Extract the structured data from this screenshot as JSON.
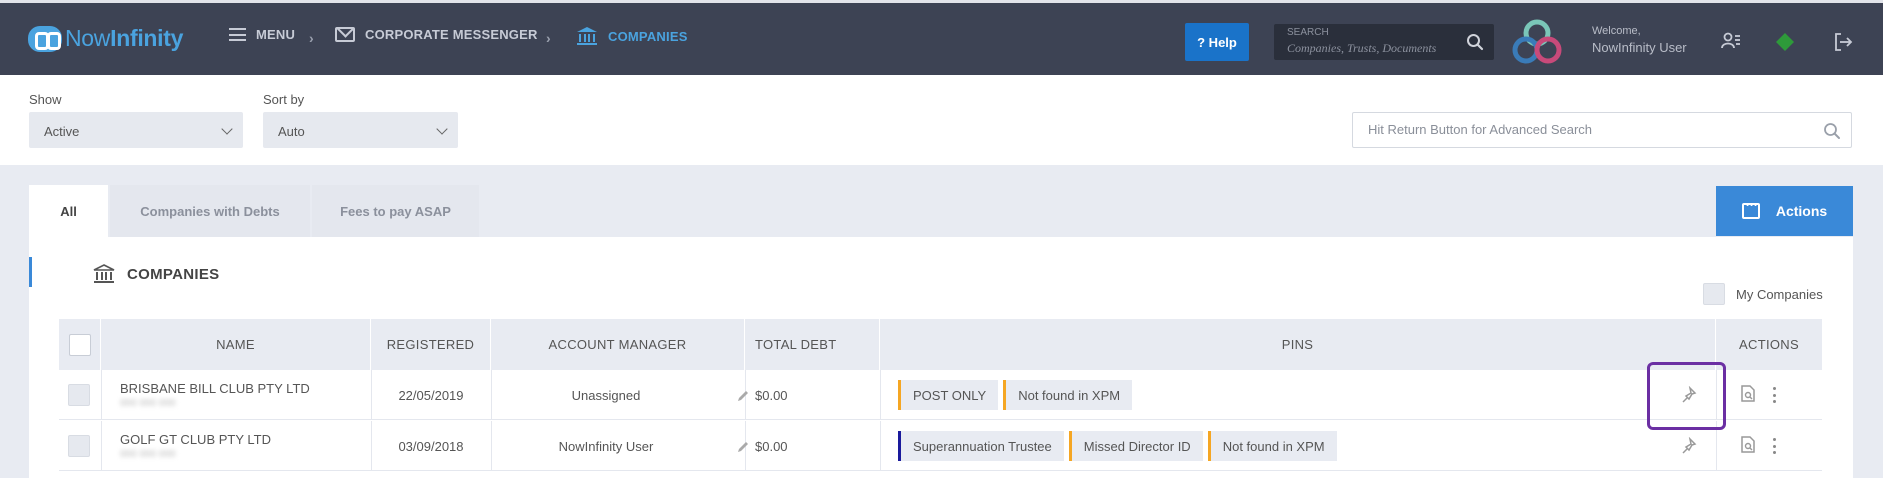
{
  "app": {
    "logo_now": "Now",
    "logo_infinity": "Infinity",
    "brand_color": "#4aa3df"
  },
  "nav": {
    "menu_label": "MENU",
    "separator": "›",
    "corporate_messenger_label": "CORPORATE MESSENGER",
    "companies_label": "COMPANIES"
  },
  "header": {
    "help_label": "? Help",
    "search_label": "SEARCH",
    "search_placeholder": "Companies, Trusts, Documents",
    "welcome_text": "Welcome,",
    "user_name": "NowInfinity User"
  },
  "filters": {
    "show_label": "Show",
    "show_value": "Active",
    "sort_label": "Sort by",
    "sort_value": "Auto",
    "advanced_search_placeholder": "Hit Return Button for Advanced Search"
  },
  "tabs": [
    {
      "label": "All",
      "active": true
    },
    {
      "label": "Companies with Debts",
      "active": false
    },
    {
      "label": "Fees to pay ASAP",
      "active": false
    }
  ],
  "actions_label": "Actions",
  "section": {
    "title": "COMPANIES",
    "my_companies_label": "My Companies"
  },
  "table": {
    "columns": [
      "NAME",
      "REGISTERED",
      "ACCOUNT MANAGER",
      "TOTAL DEBT",
      "PINS",
      "ACTIONS"
    ],
    "rows": [
      {
        "name": "BRISBANE BILL CLUB PTY LTD",
        "sub": "000 000 000",
        "registered": "22/05/2019",
        "account_manager": "Unassigned",
        "total_debt": "$0.00",
        "pins": [
          {
            "label": "POST ONLY",
            "color": "#f5a623"
          },
          {
            "label": "Not found in XPM",
            "color": "#f5a623"
          }
        ]
      },
      {
        "name": "GOLF GT CLUB PTY LTD",
        "sub": "000 000 000",
        "registered": "03/09/2018",
        "account_manager": "NowInfinity User",
        "total_debt": "$0.00",
        "pins": [
          {
            "label": "Superannuation Trustee",
            "color": "#1a1a9c"
          },
          {
            "label": "Missed Director ID",
            "color": "#f5a623"
          },
          {
            "label": "Not found in XPM",
            "color": "#f5a623"
          }
        ]
      }
    ]
  },
  "icons": {
    "menu": "hamburger-icon",
    "messenger": "envelope-icon",
    "companies": "bank-icon",
    "search": "search-icon",
    "profile": "user-card-icon",
    "status": "green-diamond-icon",
    "logout": "logout-icon",
    "edit": "pencil-icon",
    "pin": "pin-icon",
    "document": "document-search-icon",
    "more": "kebab-icon"
  },
  "highlight_color": "#6b2fa3"
}
